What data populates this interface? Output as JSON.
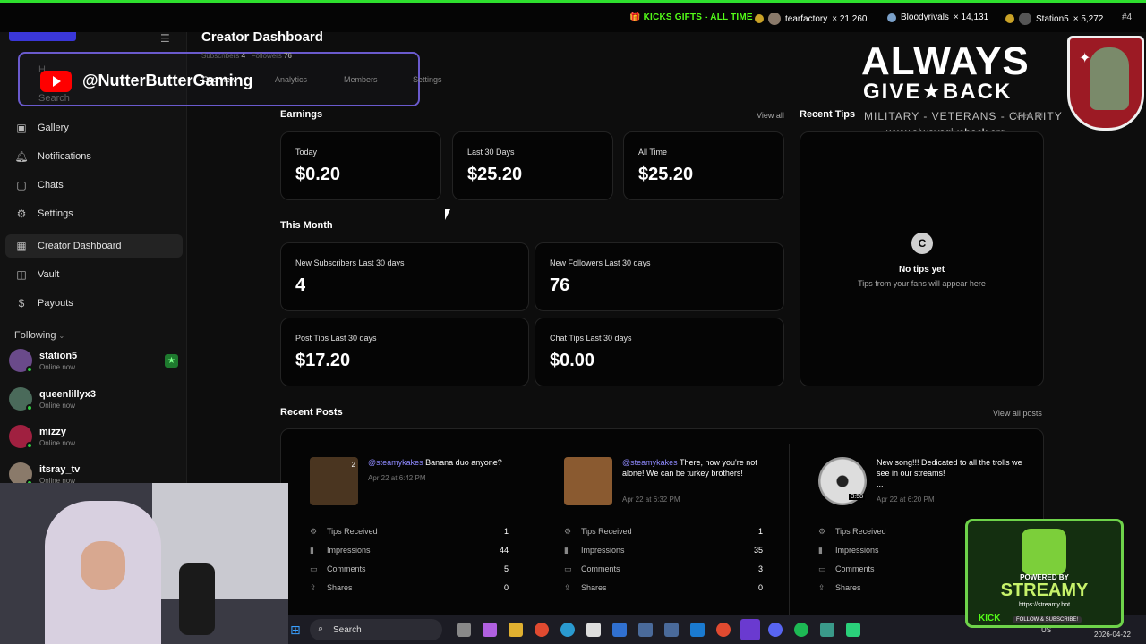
{
  "ticker": {
    "gifts_label": "🎁 KICKS GIFTS - ALL TIME",
    "entries": [
      {
        "name": "tearfactory",
        "amount": "× 21,260"
      },
      {
        "name": "Bloodyrivals",
        "amount": "× 14,131"
      },
      {
        "name": "Station5",
        "amount": "× 5,272"
      }
    ],
    "rank": "#4"
  },
  "overlay": {
    "youtube_handle": "@NutterButterGaming",
    "ghost_home": "H",
    "ghost_search": "Search"
  },
  "sidebar": {
    "items": [
      {
        "label": "Gallery",
        "icon": "gallery-icon"
      },
      {
        "label": "Notifications",
        "icon": "bell-icon"
      },
      {
        "label": "Chats",
        "icon": "chat-icon"
      },
      {
        "label": "Settings",
        "icon": "gear-icon"
      },
      {
        "label": "Creator Dashboard",
        "icon": "dashboard-icon"
      },
      {
        "label": "Vault",
        "icon": "vault-icon"
      },
      {
        "label": "Payouts",
        "icon": "dollar-icon"
      }
    ],
    "following_label": "Following",
    "following": [
      {
        "name": "station5",
        "status": "Online now"
      },
      {
        "name": "queenlillyx3",
        "status": "Online now"
      },
      {
        "name": "mizzy",
        "status": "Online now"
      },
      {
        "name": "itsray_tv",
        "status": "Online now"
      }
    ]
  },
  "header": {
    "title": "Creator Dashboard",
    "subscribers_label": "Subscribers",
    "subscribers_value": "4",
    "followers_label": "Followers",
    "followers_value": "76",
    "tabs": [
      "Overview",
      "Analytics",
      "Members",
      "Settings"
    ]
  },
  "charity": {
    "title": "ALWAYS",
    "sub": "GIVE★BACK",
    "tag": "MILITARY - VETERANS - CHARITY",
    "url": "www.alwaysgiveback.org"
  },
  "earnings": {
    "title": "Earnings",
    "view_all": "View all",
    "cards": [
      {
        "label": "Today",
        "value": "$0.20"
      },
      {
        "label": "Last 30 Days",
        "value": "$25.20"
      },
      {
        "label": "All Time",
        "value": "$25.20"
      }
    ]
  },
  "recent_tips": {
    "title": "Recent Tips",
    "view_all": "View all",
    "icon": "C",
    "empty_title": "No tips yet",
    "empty_desc": "Tips from your fans will appear here"
  },
  "this_month": {
    "title": "This Month",
    "cards": [
      {
        "label": "New Subscribers Last 30 days",
        "value": "4"
      },
      {
        "label": "New Followers Last 30 days",
        "value": "76"
      },
      {
        "label": "Post Tips Last 30 days",
        "value": "$17.20"
      },
      {
        "label": "Chat Tips Last 30 days",
        "value": "$0.00"
      }
    ]
  },
  "recent_posts": {
    "title": "Recent Posts",
    "view_all": "View all posts",
    "stat_labels": [
      "Tips Received",
      "Impressions",
      "Comments",
      "Shares"
    ],
    "posts": [
      {
        "user": "@steamykakes",
        "text": " Banana duo anyone?",
        "date": "Apr 22 at 6:42 PM",
        "thumb_badge": "2",
        "stats": [
          "1",
          "44",
          "5",
          "0"
        ]
      },
      {
        "user": "@steamykakes",
        "text": " There, now you're not alone!  We can be turkey brothers!",
        "date": "Apr 22 at 6:32 PM",
        "thumb_badge": "",
        "stats": [
          "1",
          "35",
          "3",
          "0"
        ]
      },
      {
        "user": "",
        "text": "New song!!! Dedicated to all the trolls we see in our streams!\n...",
        "date": "Apr 22 at 6:20 PM",
        "thumb_badge": "3:58",
        "stats": [
          "",
          "",
          "",
          ""
        ]
      }
    ]
  },
  "taskbar": {
    "search": "Search",
    "lang": "US",
    "date": "2026-04-22"
  },
  "streamy": {
    "powered": "POWERED BY",
    "brand": "STREAMY",
    "url": "https://streamy.bot",
    "kick": "KICK",
    "follow": "FOLLOW & SUBSCRIBE!"
  }
}
